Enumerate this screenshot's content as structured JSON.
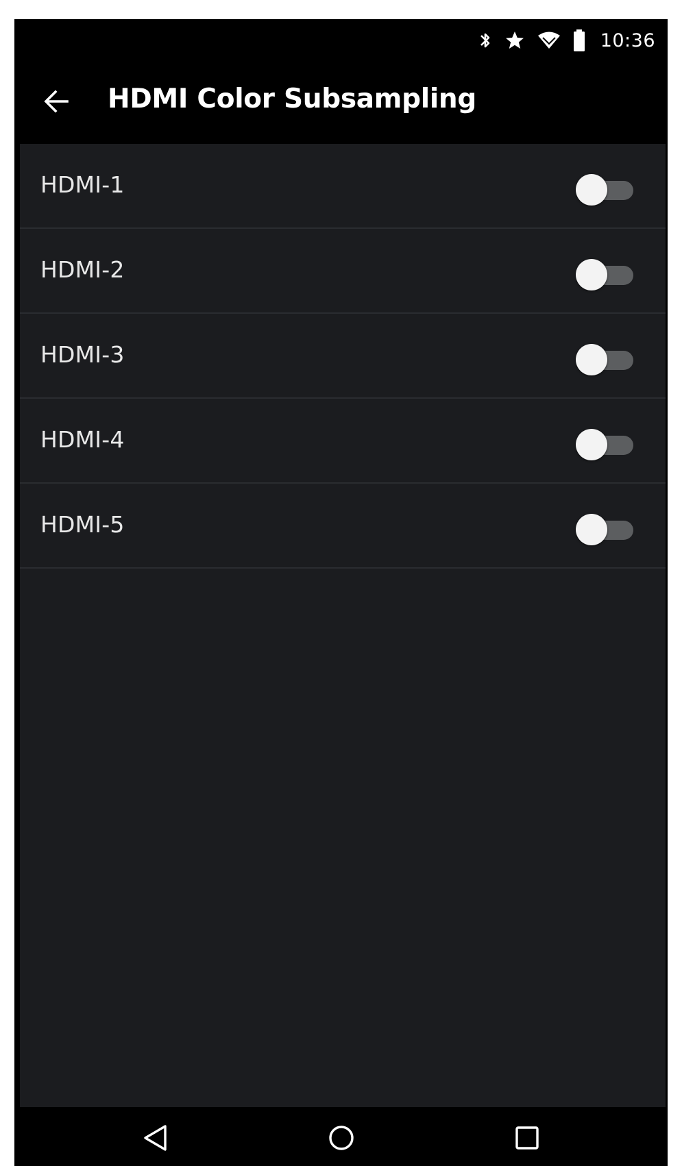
{
  "status_bar": {
    "time": "10:36",
    "icons": [
      "bluetooth-icon",
      "star-icon",
      "wifi-icon",
      "battery-icon"
    ]
  },
  "app_bar": {
    "back_icon": "arrow-left-icon",
    "title": "HDMI Color Subsampling"
  },
  "settings": {
    "items": [
      {
        "label": "HDMI-1",
        "enabled": false
      },
      {
        "label": "HDMI-2",
        "enabled": false
      },
      {
        "label": "HDMI-3",
        "enabled": false
      },
      {
        "label": "HDMI-4",
        "enabled": false
      },
      {
        "label": "HDMI-5",
        "enabled": false
      }
    ]
  },
  "nav_bar": {
    "icons": [
      "back-triangle-icon",
      "home-circle-icon",
      "recents-square-icon"
    ]
  },
  "colors": {
    "background": "#000000",
    "list_background": "#1b1c1f",
    "divider": "#2a2c30",
    "switch_track_off": "#5c5e60",
    "switch_thumb_off": "#f3f3f3",
    "text_primary": "#ffffff"
  }
}
